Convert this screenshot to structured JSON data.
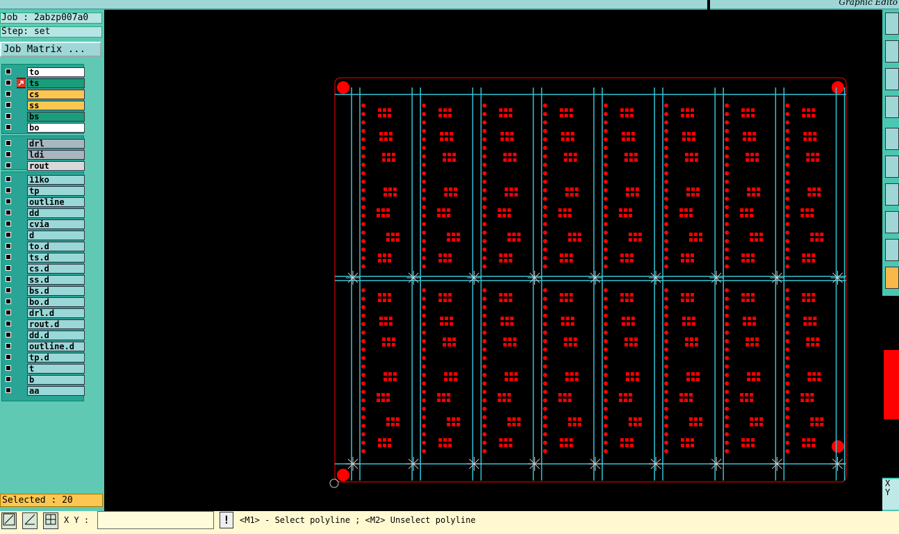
{
  "app_title": "Graphic Edito",
  "job": "Job : 2abzp007a0",
  "step": "Step: set",
  "job_matrix_button": "Job Matrix ...",
  "layers": {
    "board": [
      {
        "name": "to",
        "color": "white"
      },
      {
        "name": "ts",
        "color": "green"
      },
      {
        "name": "cs",
        "color": "yellow"
      },
      {
        "name": "ss",
        "color": "yellow"
      },
      {
        "name": "bs",
        "color": "green"
      },
      {
        "name": "bo",
        "color": "white"
      }
    ],
    "drill": [
      {
        "name": "drl",
        "color": "grey"
      },
      {
        "name": "ldi",
        "color": "grey"
      },
      {
        "name": "rout",
        "color": "lgrey"
      }
    ],
    "misc": [
      {
        "name": "11ko"
      },
      {
        "name": "tp"
      },
      {
        "name": "outline"
      },
      {
        "name": "dd"
      },
      {
        "name": "cvia"
      },
      {
        "name": "d"
      },
      {
        "name": "to.d"
      },
      {
        "name": "ts.d"
      },
      {
        "name": "cs.d"
      },
      {
        "name": "ss.d"
      },
      {
        "name": "bs.d"
      },
      {
        "name": "bo.d"
      },
      {
        "name": "drl.d"
      },
      {
        "name": "rout.d"
      },
      {
        "name": "dd.d"
      },
      {
        "name": "outline.d"
      },
      {
        "name": "tp.d"
      },
      {
        "name": "t"
      },
      {
        "name": "b"
      },
      {
        "name": "aa"
      }
    ]
  },
  "selected_text": "Selected : 20",
  "xy_label": "X Y :",
  "xy_value": "",
  "exclaim_label": "!",
  "status_message": "<M1> - Select polyline ; <M2> Unselect polyline",
  "right_xy": {
    "x": "X",
    "y": "Y"
  },
  "colors": {
    "pad_red": "#ff0000",
    "profile_cyan": "#33c6d8",
    "panel_teal": "#5fc9b4",
    "active_yellow": "#fbc750"
  }
}
